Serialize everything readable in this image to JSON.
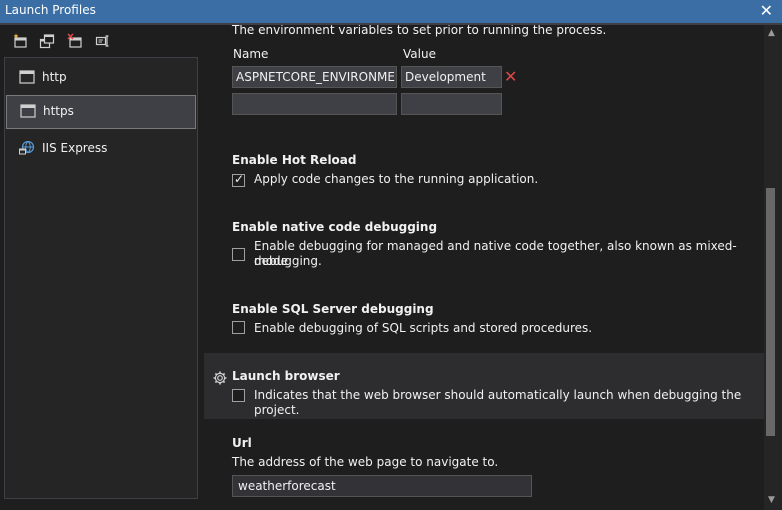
{
  "window": {
    "title": "Launch Profiles",
    "close_glyph": "✕"
  },
  "toolbar": {
    "icons": [
      "new-profile-icon",
      "copy-profile-icon",
      "delete-profile-icon",
      "rename-profile-icon"
    ]
  },
  "sidebar": {
    "items": [
      {
        "label": "http",
        "icon": "window-icon",
        "selected": false
      },
      {
        "label": "https",
        "icon": "window-icon",
        "selected": true
      },
      {
        "label": "IIS Express",
        "icon": "globe-icon",
        "selected": false
      }
    ]
  },
  "env": {
    "description": "The environment variables to set prior to running the process.",
    "name_header": "Name",
    "value_header": "Value",
    "rows": [
      {
        "name": "ASPNETCORE_ENVIRONMENT",
        "value": "Development"
      },
      {
        "name": "",
        "value": ""
      }
    ],
    "remove_glyph": "✕"
  },
  "hot_reload": {
    "heading": "Enable Hot Reload",
    "checkbox_label": "Apply code changes to the running application.",
    "checked": true,
    "check_glyph": "✓"
  },
  "native_debug": {
    "heading": "Enable native code debugging",
    "checkbox_label_line1": "Enable debugging for managed and native code together, also known as mixed-mode",
    "checkbox_label_line2": "debugging.",
    "checked": false
  },
  "sql_debug": {
    "heading": "Enable SQL Server debugging",
    "checkbox_label": "Enable debugging of SQL scripts and stored procedures.",
    "checked": false
  },
  "launch_browser": {
    "heading": "Launch browser",
    "checkbox_label": "Indicates that the web browser should automatically launch when debugging the project.",
    "checked": false
  },
  "url": {
    "heading": "Url",
    "description": "The address of the web page to navigate to.",
    "value": "weatherforecast"
  },
  "scrollbar": {
    "up_glyph": "▲",
    "down_glyph": "▼"
  },
  "colors": {
    "titlebar": "#3a6ea5",
    "accent_remove": "#e04848",
    "selected_item": "#3f3f46"
  }
}
